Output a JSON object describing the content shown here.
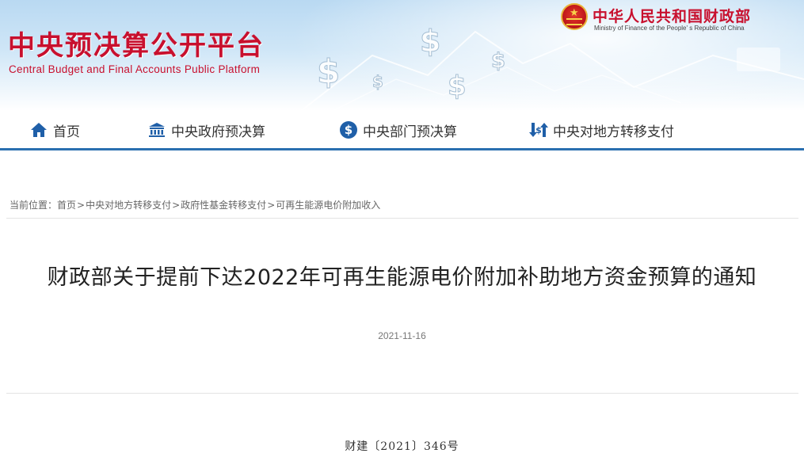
{
  "header": {
    "site_title": "中央预决算公开平台",
    "site_subtitle": "Central Budget and Final Accounts Public Platform",
    "ministry_name_cn": "中华人民共和国财政部",
    "ministry_name_en": "Ministry of Finance of the People' s Republic of China"
  },
  "nav": {
    "items": [
      {
        "label": "首页",
        "icon": "home-icon"
      },
      {
        "label": "中央政府预决算",
        "icon": "government-building-icon"
      },
      {
        "label": "中央部门预决算",
        "icon": "dollar-coin-icon"
      },
      {
        "label": "中央对地方转移支付",
        "icon": "transfer-arrows-icon"
      }
    ]
  },
  "breadcrumb": {
    "prefix": "当前位置：",
    "items": [
      "首页",
      "中央对地方转移支付",
      "政府性基金转移支付",
      "可再生能源电价附加收入"
    ],
    "separator": ">"
  },
  "article": {
    "title": "财政部关于提前下达2022年可再生能源电价附加补助地方资金预算的通知",
    "date": "2021-11-16",
    "doc_number": "财建〔2021〕346号"
  },
  "colors": {
    "brand_red": "#c8102e",
    "nav_accent": "#2a6fb0",
    "icon_blue": "#1f5fa8",
    "text": "#222222",
    "muted": "#777777"
  }
}
